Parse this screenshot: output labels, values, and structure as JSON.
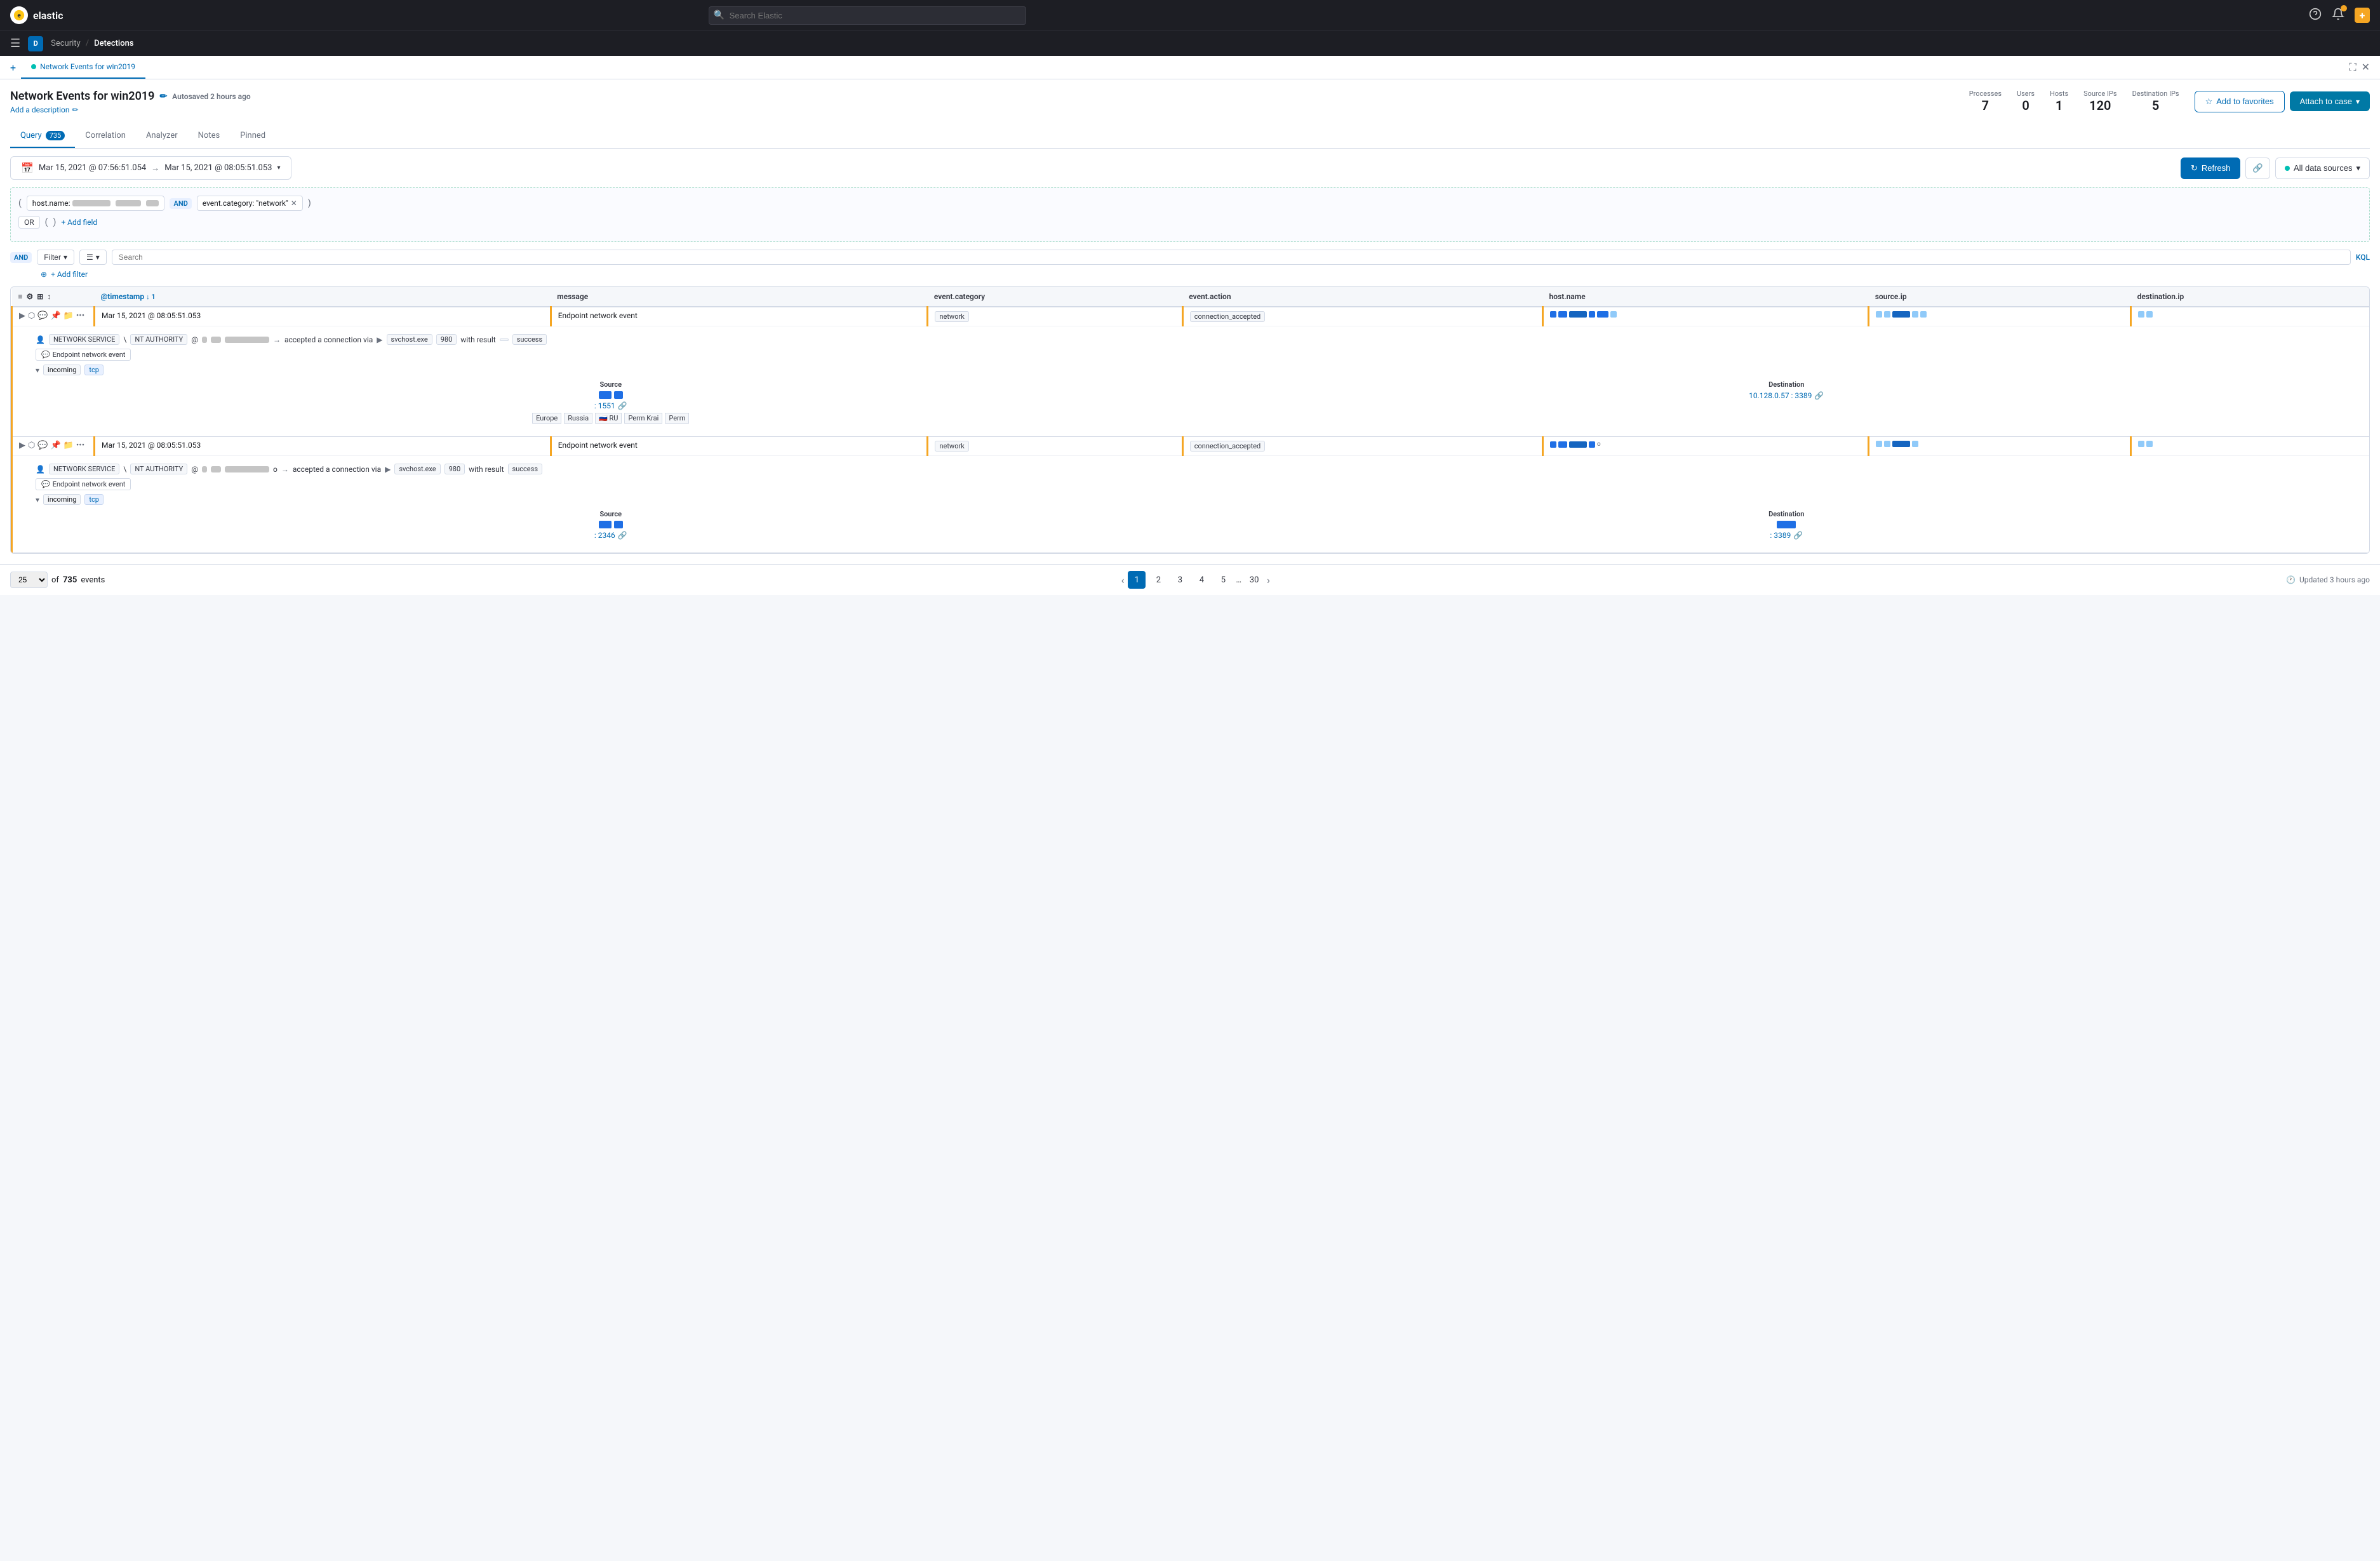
{
  "app": {
    "name": "elastic",
    "logo_initial": "E"
  },
  "topnav": {
    "search_placeholder": "Search Elastic",
    "breadcrumb_parent": "Security",
    "breadcrumb_current": "Detections",
    "nav_avatar": "D"
  },
  "timeline": {
    "tab_label": "Network Events for win2019",
    "tab_dot_color": "#00bfb3",
    "title": "Network Events for win2019",
    "autosaved": "Autosaved 2 hours ago",
    "add_description": "Add a description",
    "stats": {
      "processes_label": "Processes",
      "processes_value": "7",
      "users_label": "Users",
      "users_value": "0",
      "hosts_label": "Hosts",
      "hosts_value": "1",
      "source_ips_label": "Source IPs",
      "source_ips_value": "120",
      "destination_ips_label": "Destination IPs",
      "destination_ips_value": "5"
    },
    "btn_favorites": "Add to favorites",
    "btn_attach": "Attach to case",
    "query_tabs": [
      {
        "label": "Query",
        "badge": "735",
        "active": true
      },
      {
        "label": "Correlation",
        "active": false
      },
      {
        "label": "Analyzer",
        "active": false
      },
      {
        "label": "Notes",
        "active": false
      },
      {
        "label": "Pinned",
        "active": false
      }
    ],
    "query": {
      "field1": "host.name:",
      "field1_value": "███████ █████ ██",
      "operator": "AND",
      "field2": "event.category: \"network\"",
      "or_label": "OR",
      "add_field": "+ Add field"
    },
    "filter_bar": {
      "and_label": "AND",
      "filter_label": "Filter",
      "search_placeholder": "Search",
      "kql_label": "KQL",
      "add_filter": "+ Add filter"
    },
    "date_range": {
      "start": "Mar 15, 2021 @ 07:56:51.054",
      "arrow": "→",
      "end": "Mar 15, 2021 @ 08:05:51.053",
      "btn_refresh": "Refresh",
      "btn_datasources": "All data sources"
    },
    "table": {
      "columns": [
        {
          "label": "",
          "key": "actions"
        },
        {
          "label": "@timestamp",
          "key": "timestamp",
          "sorted": true,
          "sort_dir": "↓",
          "sort_num": "1"
        },
        {
          "label": "message",
          "key": "message"
        },
        {
          "label": "event.category",
          "key": "event_category"
        },
        {
          "label": "event.action",
          "key": "event_action"
        },
        {
          "label": "host.name",
          "key": "host_name"
        },
        {
          "label": "source.ip",
          "key": "source_ip"
        },
        {
          "label": "destination.ip",
          "key": "destination_ip"
        }
      ],
      "rows": [
        {
          "timestamp": "Mar 15, 2021 @ 08:05:51.053",
          "message": "Endpoint network event",
          "event_category": "network",
          "event_action": "connection_accepted",
          "host_name_bars": "████ ██ ████ ██",
          "source_ip_bars": "██ ██ ████ ██",
          "destination_ip_bars": "██ ██",
          "expanded": true,
          "detail": {
            "user": "NETWORK SERVICE",
            "domain": "NT AUTHORITY",
            "at": "@",
            "host_val": "«",
            "process": "svchost.exe",
            "pid": "980",
            "result": "success",
            "event_label": "Endpoint network event",
            "direction": "incoming",
            "protocol": "tcp",
            "source_label": "Source",
            "source_ip": "10.xxx.xxx.xxx",
            "source_port": "1551",
            "source_tags": [
              "Europe",
              "Russia",
              "RU",
              "Perm Krai",
              "Perm"
            ],
            "destination_label": "Destination",
            "destination_ip": "10.128.0.57",
            "destination_port": "3389"
          }
        },
        {
          "timestamp": "Mar 15, 2021 @ 08:05:51.053",
          "message": "Endpoint network event",
          "event_category": "network",
          "event_action": "connection_accepted",
          "host_name_bars": "████ ██ ████ o",
          "source_ip_bars": "██ ██ ████ ██",
          "destination_ip_bars": "██ ██",
          "expanded": true,
          "detail": {
            "user": "NETWORK SERVICE",
            "domain": "NT AUTHORITY",
            "at": "@",
            "host_val": "«",
            "process": "svchost.exe",
            "pid": "980",
            "result": "success",
            "event_label": "Endpoint network event",
            "direction": "incoming",
            "protocol": "tcp",
            "source_label": "Source",
            "source_ip": "██████",
            "source_port": "2346",
            "destination_label": "Destination",
            "destination_ip": "██████████",
            "destination_port": "3389"
          }
        }
      ]
    },
    "bottom": {
      "page_size": "25",
      "total_label": "of",
      "total": "735",
      "events_label": "events",
      "pages": [
        "1",
        "2",
        "3",
        "4",
        "5",
        "...",
        "30"
      ],
      "current_page": "1",
      "updated": "Updated 3 hours ago"
    }
  }
}
